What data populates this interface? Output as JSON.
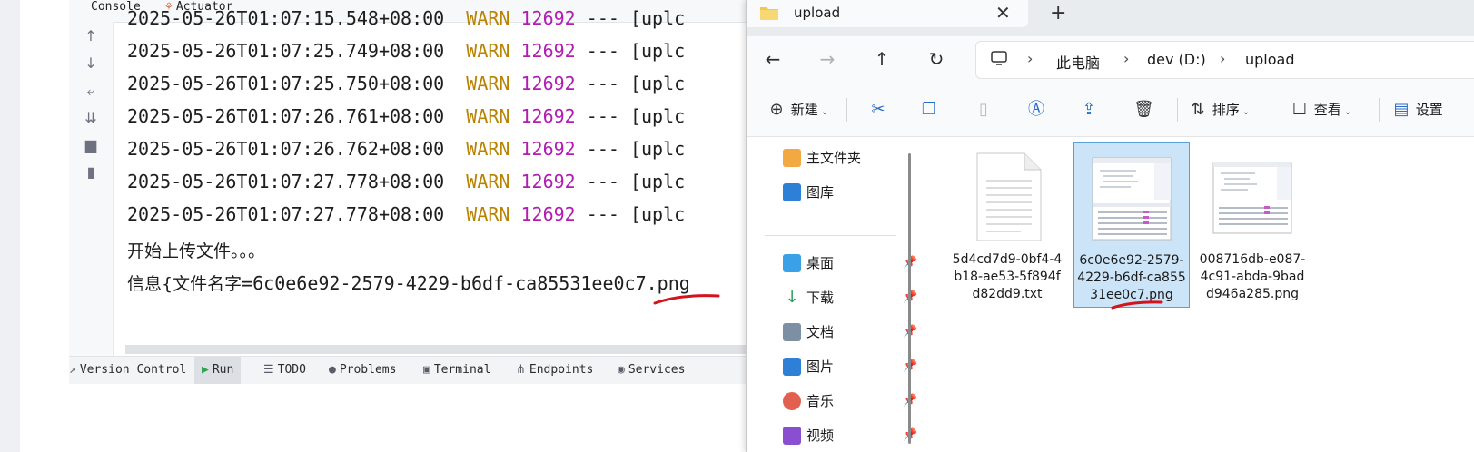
{
  "ide": {
    "tabs": [
      {
        "label": "Console",
        "icon": "console-icon"
      },
      {
        "label": "Actuator",
        "icon": "actuator-icon"
      }
    ],
    "log_lines": [
      {
        "ts": "2025-05-26T01:07:15.548+08:00",
        "level": "WARN",
        "pid": "12692",
        "rest": "--- [uplc"
      },
      {
        "ts": "2025-05-26T01:07:25.749+08:00",
        "level": "WARN",
        "pid": "12692",
        "rest": "--- [uplc"
      },
      {
        "ts": "2025-05-26T01:07:25.750+08:00",
        "level": "WARN",
        "pid": "12692",
        "rest": "--- [uplc"
      },
      {
        "ts": "2025-05-26T01:07:26.761+08:00",
        "level": "WARN",
        "pid": "12692",
        "rest": "--- [uplc"
      },
      {
        "ts": "2025-05-26T01:07:26.762+08:00",
        "level": "WARN",
        "pid": "12692",
        "rest": "--- [uplc"
      },
      {
        "ts": "2025-05-26T01:07:27.778+08:00",
        "level": "WARN",
        "pid": "12692",
        "rest": "--- [uplc"
      },
      {
        "ts": "2025-05-26T01:07:27.778+08:00",
        "level": "WARN",
        "pid": "12692",
        "rest": "--- [uplc"
      }
    ],
    "msg_start": "开始上传文件。。。",
    "msg_info_prefix": "信息{文件名字",
    "msg_info_value": "=6c0e6e92-2579-4229-b6df-ca85531ee0c7.png",
    "gutter_icons": [
      "arrow-up-icon",
      "arrow-down-icon",
      "soft-wrap-icon",
      "scroll-to-end-icon",
      "print-icon",
      "trash-icon"
    ],
    "toolbar": [
      {
        "label": "Version Control",
        "icon": "version-control-icon"
      },
      {
        "label": "Run",
        "icon": "run-icon"
      },
      {
        "label": "TODO",
        "icon": "todo-icon"
      },
      {
        "label": "Problems",
        "icon": "problems-icon"
      },
      {
        "label": "Terminal",
        "icon": "terminal-icon"
      },
      {
        "label": "Endpoints",
        "icon": "endpoints-icon"
      },
      {
        "label": "Services",
        "icon": "services-icon"
      }
    ]
  },
  "explorer": {
    "tab_title": "upload",
    "breadcrumb": [
      "此电脑",
      "dev (D:)",
      "upload"
    ],
    "commands": {
      "new": "新建",
      "sort": "排序",
      "view": "查看",
      "settings": "设置"
    },
    "sidebar": {
      "top": [
        {
          "label": "主文件夹",
          "icon": "home-icon"
        },
        {
          "label": "图库",
          "icon": "gallery-icon"
        }
      ],
      "pinned": [
        {
          "label": "桌面",
          "icon": "desktop-icon"
        },
        {
          "label": "下载",
          "icon": "download-icon"
        },
        {
          "label": "文档",
          "icon": "documents-icon"
        },
        {
          "label": "图片",
          "icon": "pictures-icon"
        },
        {
          "label": "音乐",
          "icon": "music-icon"
        },
        {
          "label": "视频",
          "icon": "videos-icon"
        }
      ]
    },
    "files": [
      {
        "name": "5d4cd7d9-0bf4-4b18-ae53-5f894fd82dd9.txt",
        "kind": "text",
        "selected": false
      },
      {
        "name": "6c0e6e92-2579-4229-b6df-ca85531ee0c7.png",
        "kind": "image",
        "selected": true
      },
      {
        "name": "008716db-e087-4c91-abda-9badd946a285.png",
        "kind": "image",
        "selected": false
      }
    ],
    "colors": {
      "selection_bg": "#cce4f7",
      "selection_border": "#5aa0d8",
      "annotation_red": "#d4141b"
    }
  }
}
